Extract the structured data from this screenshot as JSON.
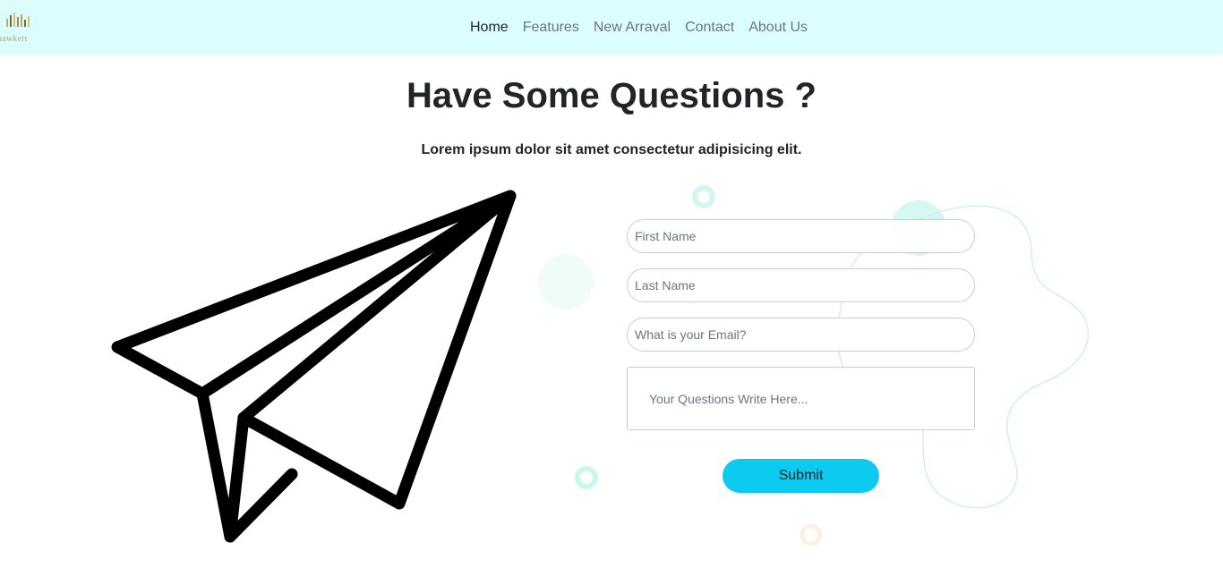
{
  "brand": {
    "name": "hawkerr",
    "icon": "equalizer-bars-icon",
    "colors": [
      "#c8a84a",
      "#6e6b55",
      "#d8c36a",
      "#9a8e5a",
      "#c8a84a",
      "#6e6b55",
      "#d8c36a"
    ]
  },
  "nav": {
    "items": [
      {
        "label": "Home",
        "active": true
      },
      {
        "label": "Features",
        "active": false
      },
      {
        "label": "New Arraval",
        "active": false
      },
      {
        "label": "Contact",
        "active": false
      },
      {
        "label": "About Us",
        "active": false
      }
    ]
  },
  "hero": {
    "title": "Have Some Questions ?",
    "subtitle": "Lorem ipsum dolor sit amet consectetur adipisicing elit."
  },
  "illustration": {
    "icon": "paper-plane-icon"
  },
  "form": {
    "first_name_placeholder": "First Name",
    "last_name_placeholder": "Last Name",
    "email_placeholder": "What is your Email?",
    "question_placeholder": "Your Questions Write Here...",
    "submit_label": "Submit"
  },
  "colors": {
    "navbar_bg": "#dcfdfd",
    "accent": "#0dcaf0",
    "decoration": "#d7f7f3"
  }
}
